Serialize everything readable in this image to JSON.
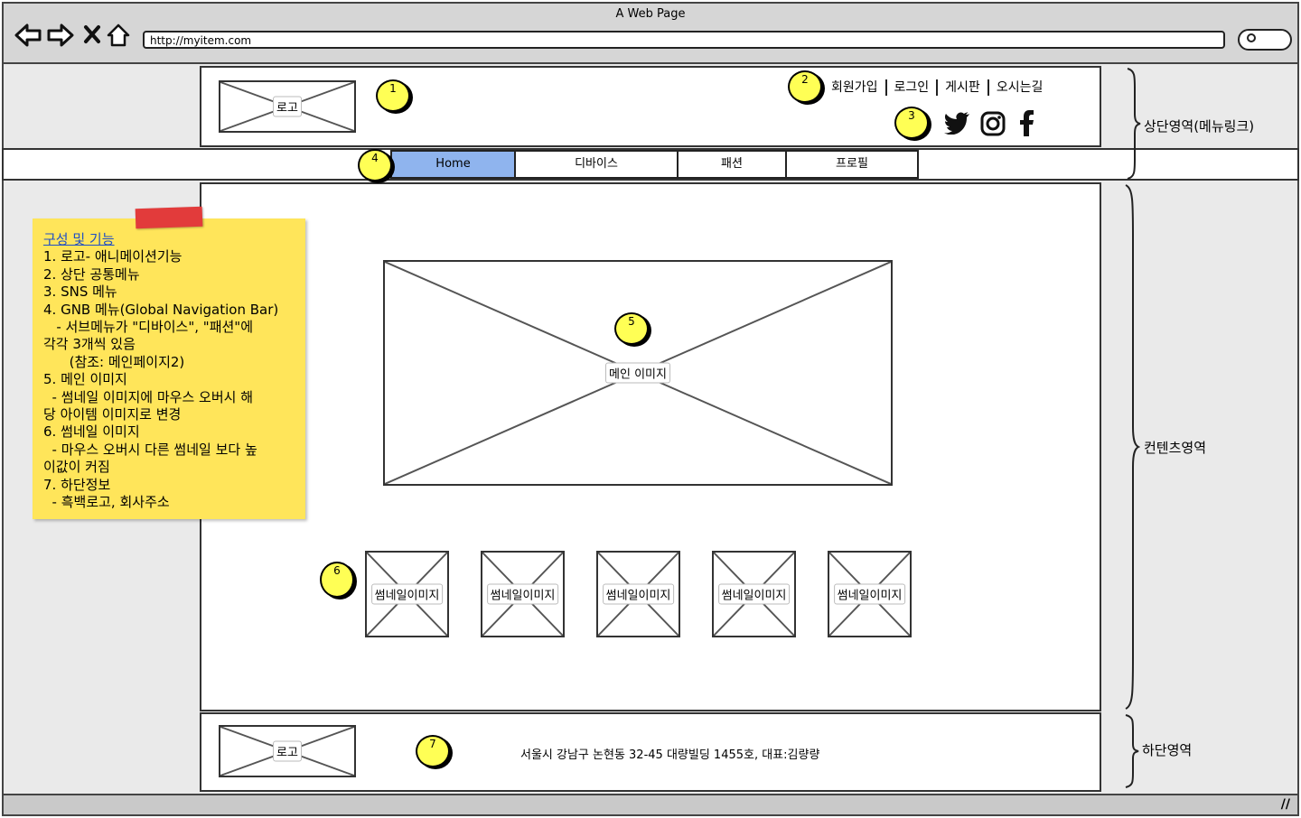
{
  "window": {
    "title": "A Web Page",
    "url": "http://myitem.com"
  },
  "header": {
    "logo_label": "로고",
    "top_links": [
      "회원가입",
      "로그인",
      "게시판",
      "오시는길"
    ]
  },
  "gnb": {
    "tabs": [
      {
        "label": "Home",
        "active": true
      },
      {
        "label": "디바이스",
        "active": false
      },
      {
        "label": "패션",
        "active": false
      },
      {
        "label": "프로필",
        "active": false
      }
    ]
  },
  "main": {
    "main_image_label": "메인 이미지",
    "thumbnails": [
      "썸네일이미지",
      "썸네일이미지",
      "썸네일이미지",
      "썸네일이미지",
      "썸네일이미지"
    ]
  },
  "footer": {
    "logo_label": "로고",
    "address": "서울시 강남구 논현동 32-45 대량빌딩 1455호, 대표:김량량"
  },
  "badges": [
    "1",
    "2",
    "3",
    "4",
    "5",
    "6",
    "7"
  ],
  "sns_icons": [
    "twitter-icon",
    "instagram-icon",
    "facebook-icon"
  ],
  "region_labels": {
    "top": "상단영역(메뉴링크)",
    "content": "컨텐츠영역",
    "bottom": "하단영역"
  },
  "note": {
    "heading": "구성 및 기능",
    "lines": [
      "1. 로고- 애니메이션기능",
      "2. 상단 공통메뉴",
      "3. SNS 메뉴",
      "4. GNB 메뉴(Global Navigation Bar)",
      "   - 서브메뉴가 \"디바이스\", \"패션\"에",
      "각각 3개씩 있음",
      "      (참조: 메인페이지2)",
      "5. 메인 이미지",
      "  - 썸네일 이미지에 마우스 오버시 해",
      "당 아이템 이미지로 변경",
      "6. 썸네일 이미지",
      "  - 마우스 오버시 다른 썸네일 보다 높",
      "이값이 커짐",
      "7. 하단정보",
      "  - 흑백로고, 회사주소"
    ]
  },
  "colors": {
    "active_tab": "#8fb4ee",
    "badge": "#ffff55",
    "sticky": "#ffe55a",
    "tape": "#e23b3b"
  }
}
